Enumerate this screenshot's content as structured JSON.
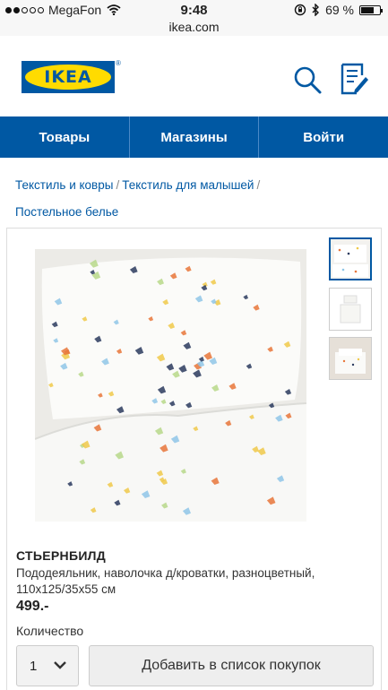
{
  "status_bar": {
    "carrier": "MegaFon",
    "time": "9:48",
    "battery": "69 %",
    "battery_level": 0.69,
    "url": "ikea.com"
  },
  "header": {
    "logo_text": "IKEA",
    "logo_reg": "®",
    "search_icon": "search-icon",
    "shopping_list_icon": "shopping-list-icon"
  },
  "nav": {
    "items": [
      "Товары",
      "Магазины",
      "Войти"
    ]
  },
  "breadcrumb": {
    "items": [
      "Текстиль и ковры",
      "Текстиль для малышей",
      "Постельное белье"
    ],
    "separator": "/"
  },
  "product": {
    "name": "СТЬЕРНБИЛД",
    "description": "Пододеяльник, наволочка д/кроватки, разноцветный, 110x125/35x55 см",
    "price": "499.-",
    "quantity_label": "Количество",
    "quantity_value": "1",
    "add_button": "Добавить в список покупок"
  },
  "colors": {
    "brand_blue": "#0058a3",
    "brand_yellow": "#ffdb00"
  }
}
